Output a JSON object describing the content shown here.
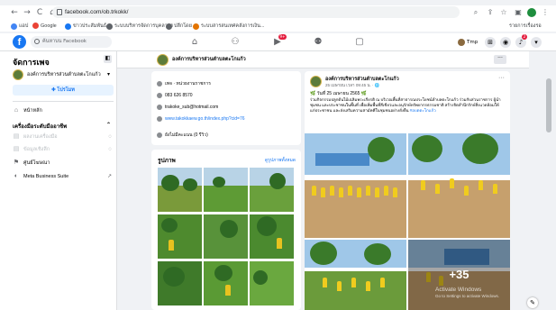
{
  "browser": {
    "url": "facebook.com/ob.trkokk/",
    "back": "←",
    "forward": "→",
    "reload": "C",
    "home": "⌂",
    "bookmarks": [
      {
        "label": "แอป",
        "color": "#4285f4"
      },
      {
        "label": "Google",
        "color": "#ea4335"
      },
      {
        "label": "ข่าวประสัมพันธ์",
        "color": "#1877f2"
      },
      {
        "label": "ระบบบริหารจัดการบุคลากร",
        "color": "#5f6368"
      },
      {
        "label": "ปลีกโดย",
        "color": "#5f6368"
      },
      {
        "label": "ระบบสารสนเทศคลังการเงิน...",
        "color": "#e37400"
      }
    ],
    "reading_list": "รายการเรื่องรอ"
  },
  "fb_top": {
    "logo": "f",
    "search_placeholder": "ค้นหาบน Facebook",
    "notification_count": "9+",
    "profile_name": "Tmp",
    "messenger_count": "2"
  },
  "sidebar": {
    "title": "จัดการเพจ",
    "page_name": "องค์การบริหารส่วนตำบลตะโกแก้ว",
    "create_button": "✚ โปรโมท",
    "items": [
      {
        "label": "หน้าหลัก",
        "icon": "⌂",
        "dim": false
      },
      {
        "label": "ผลงานเครื่องมือ",
        "icon": "▤",
        "dim": true
      },
      {
        "label": "ข้อมูลเชิงลึก",
        "icon": "▤",
        "dim": true
      },
      {
        "label": "ศูนย์โฆษณา",
        "icon": "⚑",
        "dim": false
      },
      {
        "label": "Meta Business Suite",
        "icon": "◐",
        "dim": false
      }
    ],
    "section_title": "เครื่องมือระดับมืออาชีพ"
  },
  "page_header": {
    "name": "องค์การบริหารส่วนตำบลตะโกแก้ว"
  },
  "intro": {
    "rows": [
      {
        "text": "เพจ · หน่วยงานราชการ",
        "link": false
      },
      {
        "text": "083 626 8570",
        "link": false
      },
      {
        "text": "trakoke_sub@hotmail.com",
        "link": false
      },
      {
        "text": "www.takokkaew.go.th/index.php?cid=76",
        "link": true
      },
      {
        "text": "ยังไม่มีคะแนน (0 รีวิว)",
        "link": false
      }
    ]
  },
  "photos": {
    "title": "รูปภาพ",
    "see_all": "ดูรูปภาพทั้งหมด"
  },
  "post": {
    "author": "องค์การบริหารส่วนตำบลตะโกแก้ว",
    "time": "25 เมษายน เวลา 09:45 น. · 🌐",
    "date_line": "🌿 วันที่ 25 เมษายน 2565 🌿",
    "body": "ร่วมกิจกรรมปลูกต้นไม้เฉลิมพระเกียรติ ณ บริเวณพื้นที่สาธารณประโยชน์ตำบลตะโกแก้ว ร่วมกับส่วนราชการ ผู้นำชุมชน และประชาชนในพื้นที่ เพื่อเพิ่มพื้นที่สีเขียวและอนุรักษ์ทรัพยากรธรรมชาติ สร้างจิตสำนึกรักษ์สิ่งแวดล้อมให้แก่ประชาชน และส่งเสริมความสามัคคีในชุมชนอย่างยั่งยืน",
    "tag": "#อบตตะโกแก้ว",
    "more_count": "+35",
    "watermark_title": "Activate Windows",
    "watermark_sub": "Go to Settings to activate Windows."
  },
  "colors": {
    "fb_blue": "#1877f2",
    "badge_red": "#e41e3f"
  }
}
